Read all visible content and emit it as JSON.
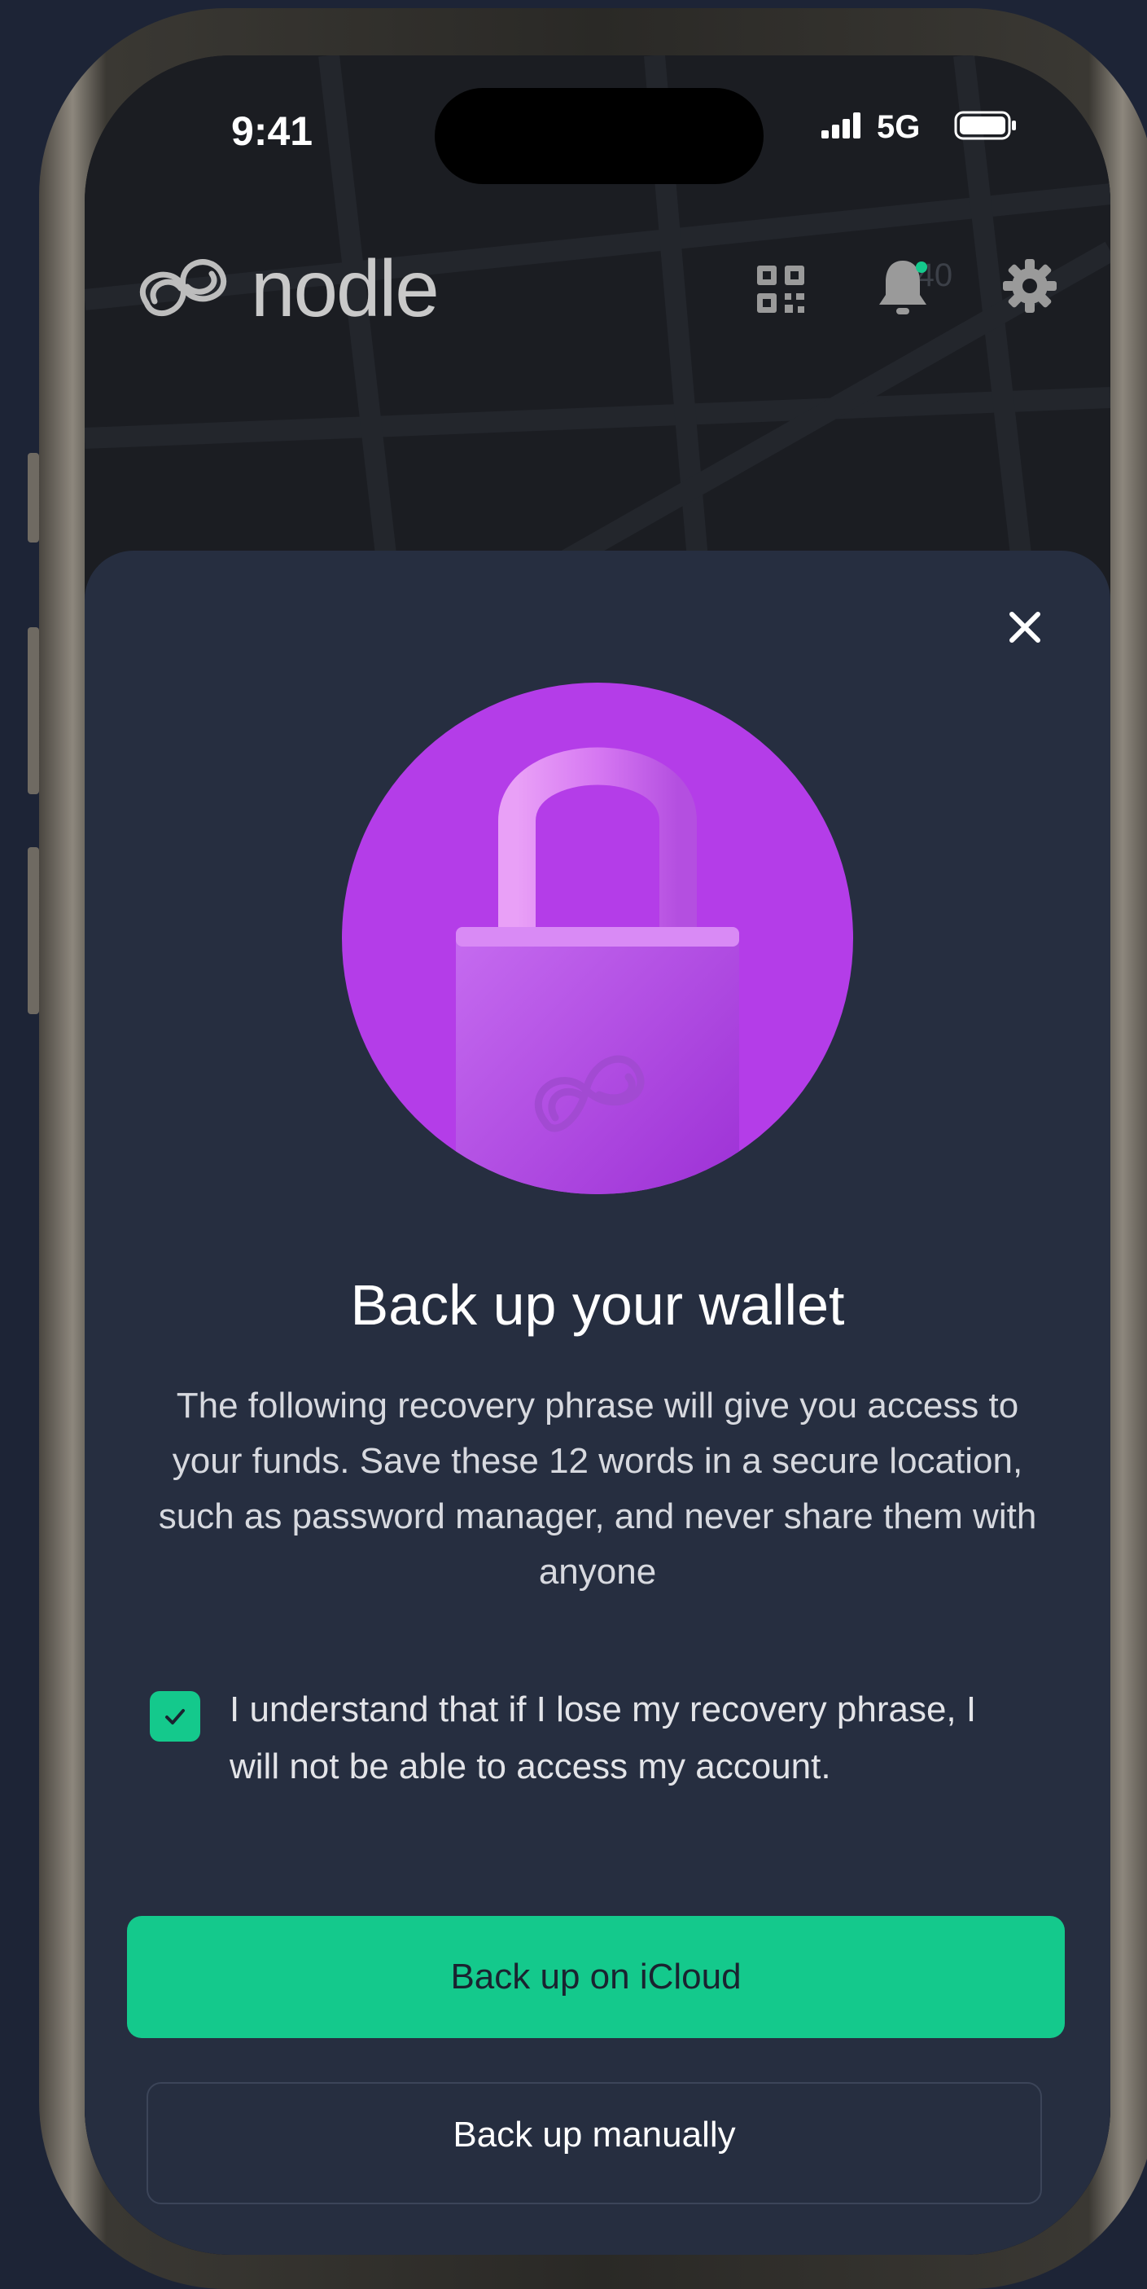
{
  "status_bar": {
    "time": "9:41",
    "network": "5G",
    "icons": [
      "signal-bars-icon",
      "battery-icon"
    ]
  },
  "header": {
    "brand_name": "nodle",
    "map_label": "A40",
    "icons": [
      "nodle-logo-icon",
      "qr-code-icon",
      "bell-icon",
      "gear-icon"
    ]
  },
  "sheet": {
    "close_icon": "close-icon",
    "hero_icon": "padlock-icon",
    "title": "Back up your wallet",
    "description": "The following recovery phrase will give you access to your funds. Save these 12 words in a secure location, such as password manager, and never share them with anyone",
    "consent": {
      "checked": true,
      "text": "I understand that if I lose my recovery phrase, I will not be able to access my account."
    },
    "primary_button": "Back up on iCloud",
    "secondary_button": "Back up manually"
  },
  "colors": {
    "accent": "#14c98c",
    "hero_purple": "#b43de8",
    "sheet_bg": "#262e40",
    "page_bg": "#1d2436"
  }
}
